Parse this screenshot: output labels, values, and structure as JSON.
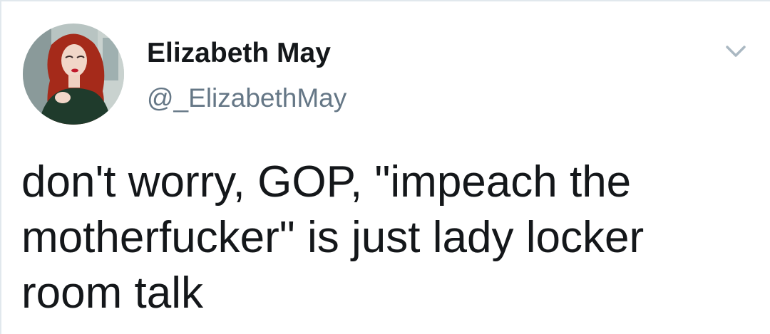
{
  "tweet": {
    "author": {
      "display_name": "Elizabeth May",
      "handle": "@_ElizabethMay",
      "avatar_icon": "profile-photo"
    },
    "menu_icon": "chevron-down-icon",
    "text": "don't worry, GOP, \"impeach the motherfucker\" is just lady locker room talk"
  },
  "colors": {
    "name": "#14171a",
    "handle": "#657786",
    "body": "#14171a",
    "caret": "#aab8c2",
    "border": "#e1e8ed"
  }
}
